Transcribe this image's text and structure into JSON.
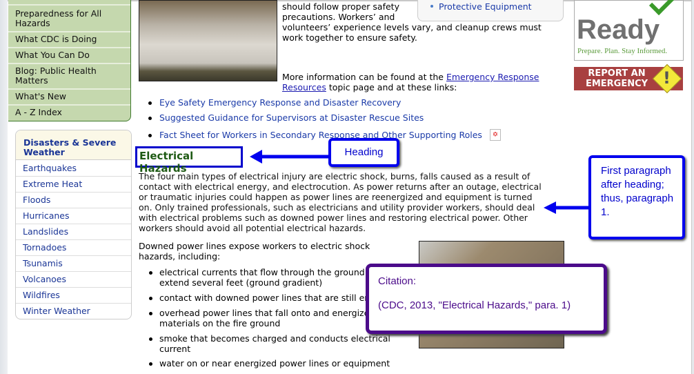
{
  "left_nav": {
    "items": [
      "Preparedness for All Hazards",
      "What CDC is Doing",
      "What You Can Do",
      "Blog: Public Health Matters",
      "What's New",
      "A - Z Index"
    ]
  },
  "disasters": {
    "title": "Disasters & Severe Weather",
    "items": [
      "Earthquakes",
      "Extreme Heat",
      "Floods",
      "Hurricanes",
      "Landslides",
      "Tornadoes",
      "Tsunamis",
      "Volcanoes",
      "Wildfires",
      "Winter Weather"
    ]
  },
  "intro": {
    "lines": [
      "should follow proper safety",
      "precautions. Workers’ and",
      "volunteers’ experience levels vary, and cleanup crews must",
      "work together to ensure safety."
    ],
    "more_prefix": "More information can be found at the ",
    "more_link": "Emergency Response Resources",
    "more_suffix": " topic page and at these links:"
  },
  "sidebar_box": {
    "item": "Protective Equipment"
  },
  "links": [
    "Eye Safety Emergency Response and Disaster Recovery",
    "Suggested Guidance for Supervisors at Disaster Rescue Sites",
    "Fact Sheet for Workers in Secondary Response and Other Supporting Roles"
  ],
  "ready": {
    "word": "Ready",
    "tagline": "Prepare. Plan. Stay Informed."
  },
  "report": {
    "label": "REPORT AN EMERGENCY"
  },
  "section": {
    "heading": "Electrical Hazards",
    "paragraph": "The four main types of electrical injury are electric shock, burns, falls caused as a result of contact with electrical energy, and electrocution. As power returns after an outage, electrical or traumatic injuries could happen as power lines are reenergized and equipment is turned on. Only trained professionals, such as electricians and utility provider workers, should deal with electrical problems such as downed power lines and restoring electrical power. Other workers should avoid all potential electrical hazards.",
    "downed": "Downed power lines expose workers to electric shock hazards, including:",
    "bullets": [
      "electrical currents that flow through the ground and extend several feet (ground gradient)",
      "contact with downed power lines that are still energized",
      "overhead power lines that fall onto and energize materials on the fire ground",
      "smoke that becomes charged and conducts electrical current",
      "water on or near energized power lines or equipment"
    ]
  },
  "annotations": {
    "heading": "Heading",
    "paragraph": "First paragraph after heading; thus, paragraph 1.",
    "citation_label": "Citation:",
    "citation": "(CDC, 2013, \"Electrical Hazards,\" para. 1)"
  },
  "colors": {
    "annotation_blue": "#0000ee",
    "citation_purple": "#4b0b8a",
    "nav_green": "#c5d8ae",
    "link_blue": "#1a3aa8",
    "heading_green": "#1e5a14"
  }
}
